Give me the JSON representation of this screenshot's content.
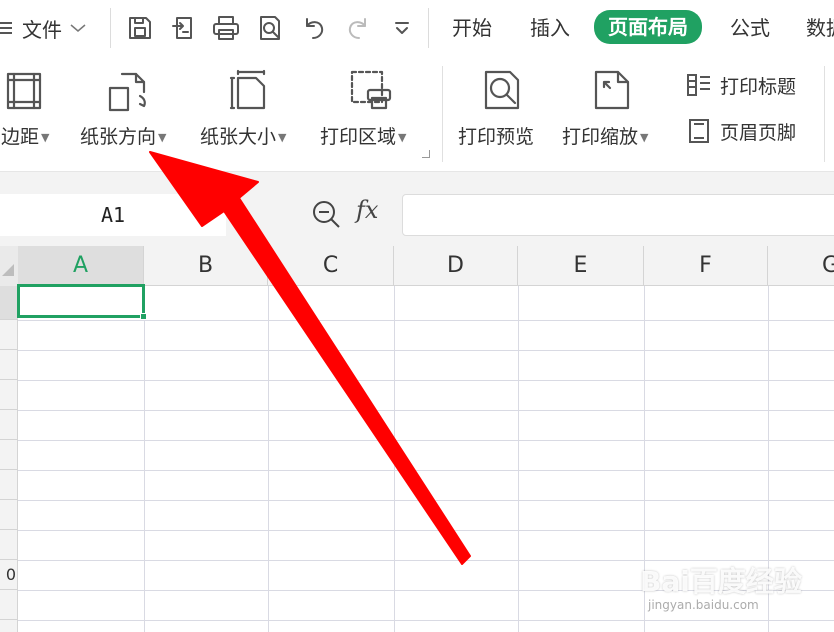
{
  "menu": {
    "file_label": "文件",
    "tabs": [
      "开始",
      "插入",
      "页面布局",
      "公式",
      "数据"
    ],
    "active_tab": "页面布局"
  },
  "ribbon": {
    "margins": "页边距",
    "orientation": "纸张方向",
    "size": "纸张大小",
    "print_area": "打印区域",
    "print_preview": "打印预览",
    "print_scale": "打印缩放",
    "print_titles": "打印标题",
    "header_footer": "页眉页脚"
  },
  "formula_bar": {
    "name_box": "A1",
    "fx_label": "fx",
    "value": ""
  },
  "sheet": {
    "columns": [
      "A",
      "B",
      "C",
      "D",
      "E",
      "F",
      "G"
    ],
    "selected_column": "A",
    "active_cell": "A1",
    "partial_row_label": "0"
  },
  "watermark": {
    "brand": "Bai百度经验",
    "url": "jingyan.baidu.com"
  },
  "colors": {
    "accent": "#20a162",
    "arrow": "#ff0000",
    "grid_line": "#d9dae3",
    "header_bg": "#f3f3f3"
  },
  "icons": [
    "menu-icon",
    "chevron-down-icon",
    "save-icon",
    "export-pdf-icon",
    "print-icon",
    "print-preview-icon",
    "undo-icon",
    "redo-icon",
    "more-icon",
    "margins-icon",
    "orientation-icon",
    "paper-size-icon",
    "print-area-icon",
    "preview-icon",
    "scale-icon",
    "print-titles-icon",
    "header-footer-icon",
    "zoom-icon"
  ]
}
